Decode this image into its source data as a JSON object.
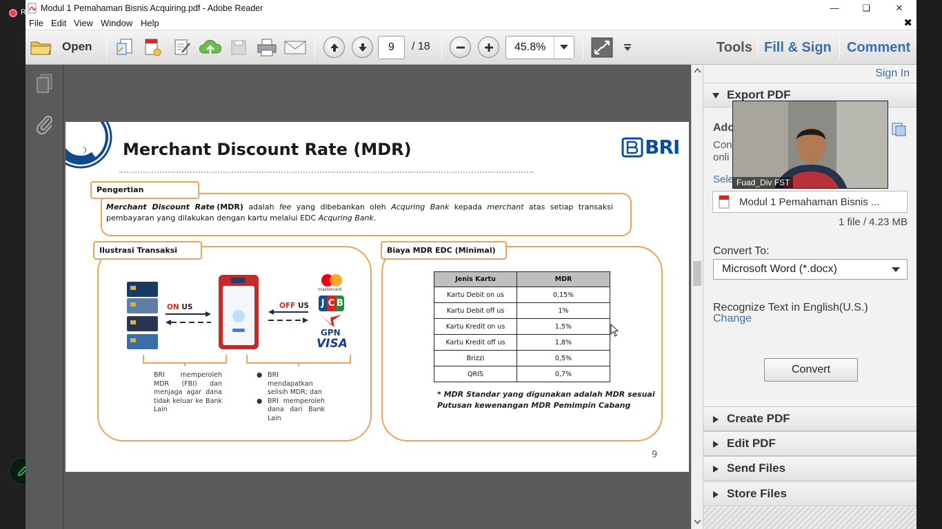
{
  "desktop": {
    "recording_text": "R"
  },
  "window": {
    "title": "Modul 1 Pemahaman Bisnis Acquiring.pdf - Adobe Reader",
    "minimize": "—",
    "maximize": "❏",
    "close": "✕"
  },
  "menu": {
    "items": [
      "File",
      "Edit",
      "View",
      "Window",
      "Help"
    ],
    "close": "✖"
  },
  "toolbar": {
    "open_label": "Open",
    "page_current": "9",
    "page_total": "/ 18",
    "zoom": "45.8%",
    "tabs": {
      "tools": "Tools",
      "fill_sign": "Fill & Sign",
      "comment": "Comment"
    }
  },
  "slide": {
    "title": "Merchant Discount Rate (MDR)",
    "logo_text": "BRI",
    "definition": {
      "label": "Pengertian",
      "term": "Merchant Discount Rate",
      "abbr": "(MDR)",
      "t1": " adalah ",
      "fee": "fee",
      "t2": " yang dibebankan oleh ",
      "bank": "Acquring Bank",
      "t3": " kepada ",
      "merchant": "merchant",
      "t4": " atas setiap transaksi pembayaran yang dilakukan dengan kartu melalui EDC ",
      "bank2": "Acquring Bank",
      "t5": "."
    },
    "illustration": {
      "label": "Ilustrasi Transaksi",
      "on_us_prefix": "ON",
      "on_us_suffix": "US",
      "off_us_prefix": "OFF",
      "off_us_suffix": "US",
      "brand_mastercard": "mastercard",
      "brand_jcb": "JCB",
      "brand_gpn": "GPN",
      "brand_visa": "VISA",
      "caption_left": "BRI memperoleh MDR (FBI) dan menjaga agar dana tidak keluar ke Bank Lain",
      "caption_right_1": "BRI mendapatkan selisih MDR; dan",
      "caption_right_2": "BRI memperoleh dana dari Bank Lain"
    },
    "mdr": {
      "label": "Biaya MDR EDC (Minimal)",
      "headers": [
        "Jenis Kartu",
        "MDR"
      ],
      "rows": [
        [
          "Kartu Debit on us",
          "0,15%"
        ],
        [
          "Kartu Debit off us",
          "1%"
        ],
        [
          "Kartu Kredit on us",
          "1,5%"
        ],
        [
          "Kartu Kredit off us",
          "1,8%"
        ],
        [
          "Brizzi",
          "0,5%"
        ],
        [
          "QRIS",
          "0,7%"
        ]
      ],
      "note_line1": "* MDR Standar yang digunakan adalah MDR sesuai",
      "note_line2": "Putusan kewenangan MDR Pemimpin Cabang"
    },
    "page_number": "9"
  },
  "right_pane": {
    "sign_in": "Sign In",
    "export_pdf": "Export PDF",
    "partial_1": "Ado",
    "partial_2": "Con",
    "partial_3": "onli",
    "partial_select": "Sele",
    "file_name": "Modul 1 Pemahaman Bisnis ...",
    "file_info": "1 file / 4.23 MB",
    "convert_to_label": "Convert To:",
    "convert_to_value": "Microsoft Word (*.docx)",
    "recognize_text": "Recognize Text in English(U.S.)",
    "change_link": "Change",
    "convert_button": "Convert",
    "sections": [
      "Create PDF",
      "Edit PDF",
      "Send Files",
      "Store Files"
    ]
  },
  "video": {
    "participant_name": "Fuad_Div FST"
  }
}
